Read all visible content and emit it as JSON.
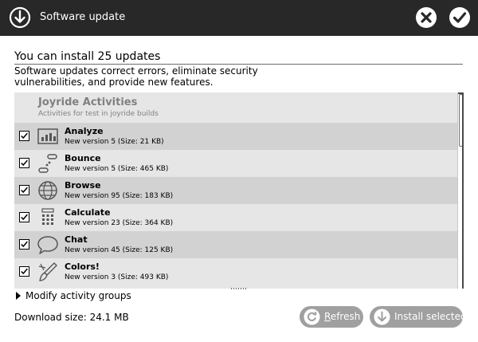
{
  "window": {
    "title": "Software update",
    "icon": "download-arrow-icon",
    "cancel_icon": "close-icon",
    "ok_icon": "checkmark-icon"
  },
  "summary": {
    "heading": "You can install 25 updates",
    "description": "Software updates correct errors, eliminate security vulnerabilities, and provide new features."
  },
  "group": {
    "title": "Joyride Activities",
    "subtitle": "Activities for test in joyride builds"
  },
  "updates": [
    {
      "name": "Analyze",
      "version": "New version 5 (Size: 21 KB)",
      "checked": true,
      "icon": "analyze-chart-icon"
    },
    {
      "name": "Bounce",
      "version": "New version 5 (Size: 465 KB)",
      "checked": true,
      "icon": "bounce-icon"
    },
    {
      "name": "Browse",
      "version": "New version 95 (Size: 183 KB)",
      "checked": true,
      "icon": "browse-globe-icon"
    },
    {
      "name": "Calculate",
      "version": "New version 23 (Size: 364 KB)",
      "checked": true,
      "icon": "calculate-keypad-icon"
    },
    {
      "name": "Chat",
      "version": "New version 45 (Size: 125 KB)",
      "checked": true,
      "icon": "chat-bubble-icon"
    },
    {
      "name": "Colors!",
      "version": "New version 3 (Size: 493 KB)",
      "checked": true,
      "icon": "colors-brush-icon"
    }
  ],
  "footer": {
    "modify_label": "Modify activity groups",
    "download_size": "Download size: 24.1 MB",
    "refresh_label": "Refresh",
    "install_label": "Install selected"
  },
  "colors": {
    "titlebar": "#282828",
    "row_dark": "#d2d2d2",
    "row_light": "#e6e6e6",
    "button": "#a0a0a0",
    "group_text": "#808080"
  }
}
